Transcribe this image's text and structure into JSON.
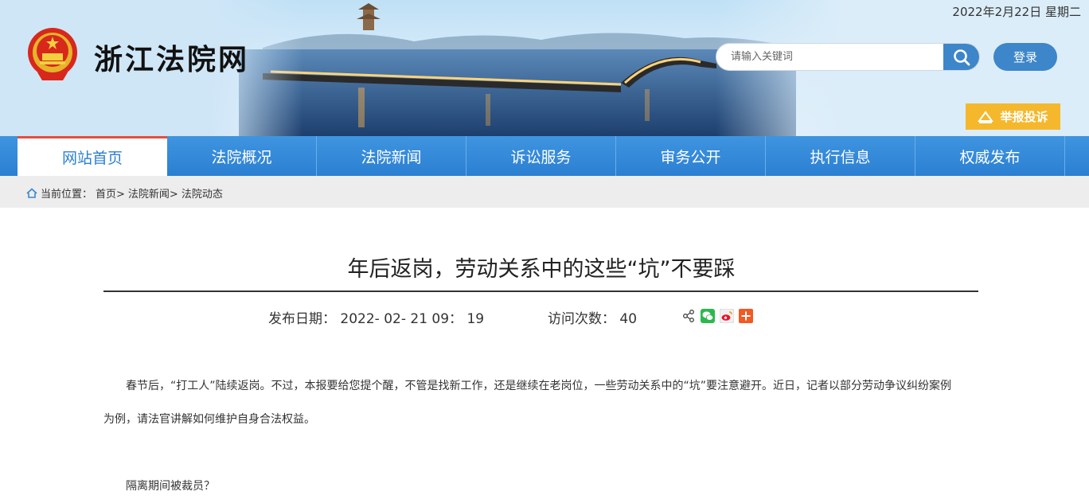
{
  "header": {
    "site_title": "浙江法院网",
    "date": "2022年2月22日 星期二",
    "search_placeholder": "请输入关键词",
    "login_label": "登录",
    "report_label": "举报投诉"
  },
  "nav": {
    "items": [
      "网站首页",
      "法院概况",
      "法院新闻",
      "诉讼服务",
      "审务公开",
      "执行信息",
      "权威发布"
    ],
    "active": "网站首页"
  },
  "breadcrumb": {
    "prefix": "当前位置：",
    "items": [
      "首页>",
      "法院新闻>",
      "法院动态"
    ]
  },
  "article": {
    "title": "年后返岗，劳动关系中的这些“坑”不要踩",
    "publish_label": "发布日期：",
    "publish_date": "2022- 02- 21 09： 19",
    "visits_label": "访问次数：",
    "visits": "40",
    "para1_line1": "春节后，“打工人”陆续返岗。不过，本报要给您提个醒，不管是找新工作，还是继续在老岗位，一些劳动关系中的“坑”要注意避开。近日，记者以部分劳动争议纠纷案例",
    "para1_line2": "为例，请法官讲解如何维护自身合法权益。",
    "para2": "隔离期间被裁员？"
  },
  "colors": {
    "nav_blue": "#2b7fd2",
    "button_blue": "#3d86c9",
    "report_orange": "#f5b82c",
    "active_red": "#e74c3c"
  },
  "icons": [
    "emblem-icon",
    "search-icon",
    "home-icon",
    "share-icon",
    "wechat-icon",
    "weibo-icon",
    "plus-share-icon",
    "report-icon"
  ]
}
